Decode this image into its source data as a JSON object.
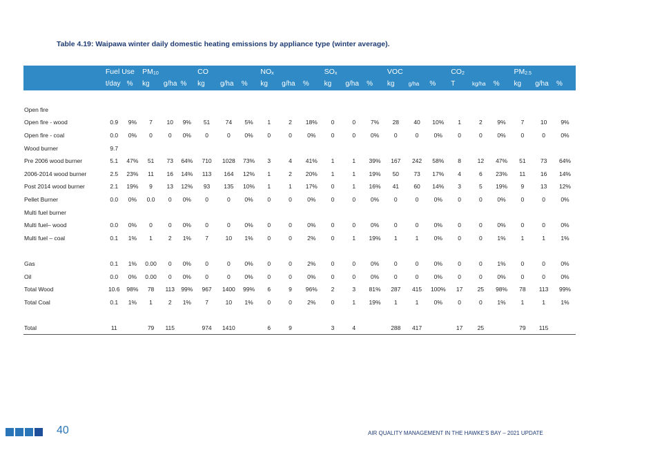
{
  "title": "Table 4.19: Waipawa winter daily domestic heating emissions by appliance type (winter average).",
  "groups": {
    "fuel_use": "Fuel Use",
    "pm10": "PM",
    "pm10_sub": "10",
    "co": "CO",
    "nox": "NO",
    "nox_sub": "x",
    "sox": "SO",
    "sox_sub": "x",
    "voc": "VOC",
    "co2": "CO",
    "co2_sub": "2",
    "pm25": "PM",
    "pm25_sub": "2.5"
  },
  "units": [
    "t/day",
    "%",
    "kg",
    "g/ha",
    "%",
    "kg",
    "g/ha",
    "%",
    "kg",
    "g/ha",
    "%",
    "kg",
    "g/ha",
    "%",
    "kg",
    "g/ha",
    "%",
    "T",
    "kg/ha",
    "%",
    "kg",
    "g/ha",
    "%"
  ],
  "rows": [
    {
      "label": "Open fire",
      "cells": [
        "",
        "",
        "",
        "",
        "",
        "",
        "",
        "",
        "",
        "",
        "",
        "",
        "",
        "",
        "",
        "",
        "",
        "",
        "",
        "",
        "",
        "",
        ""
      ]
    },
    {
      "label": "Open fire - wood",
      "cells": [
        "0.9",
        "9%",
        "7",
        "10",
        "9%",
        "51",
        "74",
        "5%",
        "1",
        "2",
        "18%",
        "0",
        "0",
        "7%",
        "28",
        "40",
        "10%",
        "1",
        "2",
        "9%",
        "7",
        "10",
        "9%"
      ]
    },
    {
      "label": "Open fire - coal",
      "cells": [
        "0.0",
        "0%",
        "0",
        "0",
        "0%",
        "0",
        "0",
        "0%",
        "0",
        "0",
        "0%",
        "0",
        "0",
        "0%",
        "0",
        "0",
        "0%",
        "0",
        "0",
        "0%",
        "0",
        "0",
        "0%"
      ]
    },
    {
      "label": "Wood burner",
      "cells": [
        "9.7",
        "",
        "",
        "",
        "",
        "",
        "",
        "",
        "",
        "",
        "",
        "",
        "",
        "",
        "",
        "",
        "",
        "",
        "",
        "",
        "",
        "",
        ""
      ]
    },
    {
      "label": "Pre 2006 wood burner",
      "cells": [
        "5.1",
        "47%",
        "51",
        "73",
        "64%",
        "710",
        "1028",
        "73%",
        "3",
        "4",
        "41%",
        "1",
        "1",
        "39%",
        "167",
        "242",
        "58%",
        "8",
        "12",
        "47%",
        "51",
        "73",
        "64%"
      ]
    },
    {
      "label": "2006-2014 wood burner",
      "cells": [
        "2.5",
        "23%",
        "11",
        "16",
        "14%",
        "113",
        "164",
        "12%",
        "1",
        "2",
        "20%",
        "1",
        "1",
        "19%",
        "50",
        "73",
        "17%",
        "4",
        "6",
        "23%",
        "11",
        "16",
        "14%"
      ]
    },
    {
      "label": "Post 2014 wood burner",
      "cells": [
        "2.1",
        "19%",
        "9",
        "13",
        "12%",
        "93",
        "135",
        "10%",
        "1",
        "1",
        "17%",
        "0",
        "1",
        "16%",
        "41",
        "60",
        "14%",
        "3",
        "5",
        "19%",
        "9",
        "13",
        "12%"
      ]
    },
    {
      "label": "Pellet Burner",
      "cells": [
        "0.0",
        "0%",
        "0.0",
        "0",
        "0%",
        "0",
        "0",
        "0%",
        "0",
        "0",
        "0%",
        "0",
        "0",
        "0%",
        "0",
        "0",
        "0%",
        "0",
        "0",
        "0%",
        "0",
        "0",
        "0%"
      ]
    },
    {
      "label": "Multi fuel burner",
      "cells": [
        "",
        "",
        "",
        "",
        "",
        "",
        "",
        "",
        "",
        "",
        "",
        "",
        "",
        "",
        "",
        "",
        "",
        "",
        "",
        "",
        "",
        "",
        ""
      ]
    },
    {
      "label": "Multi fuel– wood",
      "cells": [
        "0.0",
        "0%",
        "0",
        "0",
        "0%",
        "0",
        "0",
        "0%",
        "0",
        "0",
        "0%",
        "0",
        "0",
        "0%",
        "0",
        "0",
        "0%",
        "0",
        "0",
        "0%",
        "0",
        "0",
        "0%"
      ]
    },
    {
      "label": "Multi fuel – coal",
      "cells": [
        "0.1",
        "1%",
        "1",
        "2",
        "1%",
        "7",
        "10",
        "1%",
        "0",
        "0",
        "2%",
        "0",
        "1",
        "19%",
        "1",
        "1",
        "0%",
        "0",
        "0",
        "1%",
        "1",
        "1",
        "1%"
      ]
    }
  ],
  "rows2": [
    {
      "label": "Gas",
      "cells": [
        "0.1",
        "1%",
        "0.00",
        "0",
        "0%",
        "0",
        "0",
        "0%",
        "0",
        "0",
        "2%",
        "0",
        "0",
        "0%",
        "0",
        "0",
        "0%",
        "0",
        "0",
        "1%",
        "0",
        "0",
        "0%"
      ]
    },
    {
      "label": "Oil",
      "cells": [
        "0.0",
        "0%",
        "0.00",
        "0",
        "0%",
        "0",
        "0",
        "0%",
        "0",
        "0",
        "0%",
        "0",
        "0",
        "0%",
        "0",
        "0",
        "0%",
        "0",
        "0",
        "0%",
        "0",
        "0",
        "0%"
      ]
    },
    {
      "label": "Total Wood",
      "cells": [
        "10.6",
        "98%",
        "78",
        "113",
        "99%",
        "967",
        "1400",
        "99%",
        "6",
        "9",
        "96%",
        "2",
        "3",
        "81%",
        "287",
        "415",
        "100%",
        "17",
        "25",
        "98%",
        "78",
        "113",
        "99%"
      ]
    },
    {
      "label": "Total Coal",
      "cells": [
        "0.1",
        "1%",
        "1",
        "2",
        "1%",
        "7",
        "10",
        "1%",
        "0",
        "0",
        "2%",
        "0",
        "1",
        "19%",
        "1",
        "1",
        "0%",
        "0",
        "0",
        "1%",
        "1",
        "1",
        "1%"
      ]
    }
  ],
  "total": {
    "label": "Total",
    "cells": [
      "11",
      "",
      "79",
      "115",
      "",
      "974",
      "1410",
      "",
      "6",
      "9",
      "",
      "3",
      "4",
      "",
      "288",
      "417",
      "",
      "17",
      "25",
      "",
      "79",
      "115",
      ""
    ]
  },
  "footer": {
    "page_number": "40",
    "text": "AIR QUALITY MANAGEMENT IN THE HAWKE'S BAY – 2021 UPDATE"
  }
}
